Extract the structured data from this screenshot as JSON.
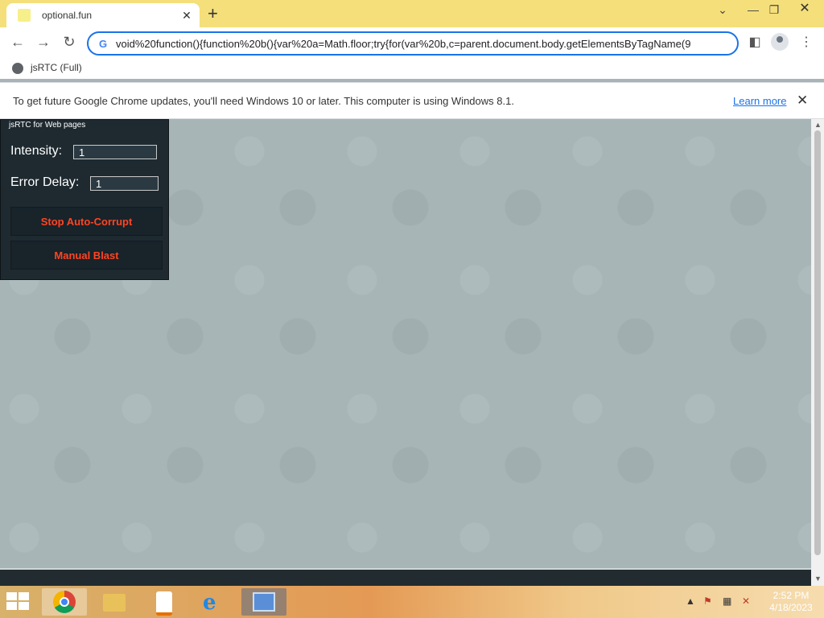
{
  "browser": {
    "tab_title": "optional.fun",
    "new_tab": "+",
    "tab_close": "✕",
    "url": "void%20function(){function%20b(){var%20a=Math.floor;try{for(var%20b,c=parent.document.body.getElementsByTagName(9",
    "bookmark_label": "jsRTC (Full)"
  },
  "infobar": {
    "message": "To get future Google Chrome updates, you'll need Windows 10 or later. This computer is using Windows 8.1.",
    "link": "Learn more",
    "close": "✕"
  },
  "rtc_panel": {
    "title": "jsRTC for Web pages",
    "intensity_label": "Intensity:",
    "intensity_value": "1",
    "error_delay_label": "Error Delay:",
    "error_delay_value": "1",
    "stop_button": "Stop Auto-Corrupt",
    "blast_button": "Manual Blast"
  },
  "taskbar": {
    "time": "2:52 PM",
    "date": "4/18/2023"
  },
  "colors": {
    "accent": "#1a73e8",
    "titlebar": "#f5df7a",
    "panel_bg": "#1e2a30",
    "button_text": "#ff4422"
  }
}
